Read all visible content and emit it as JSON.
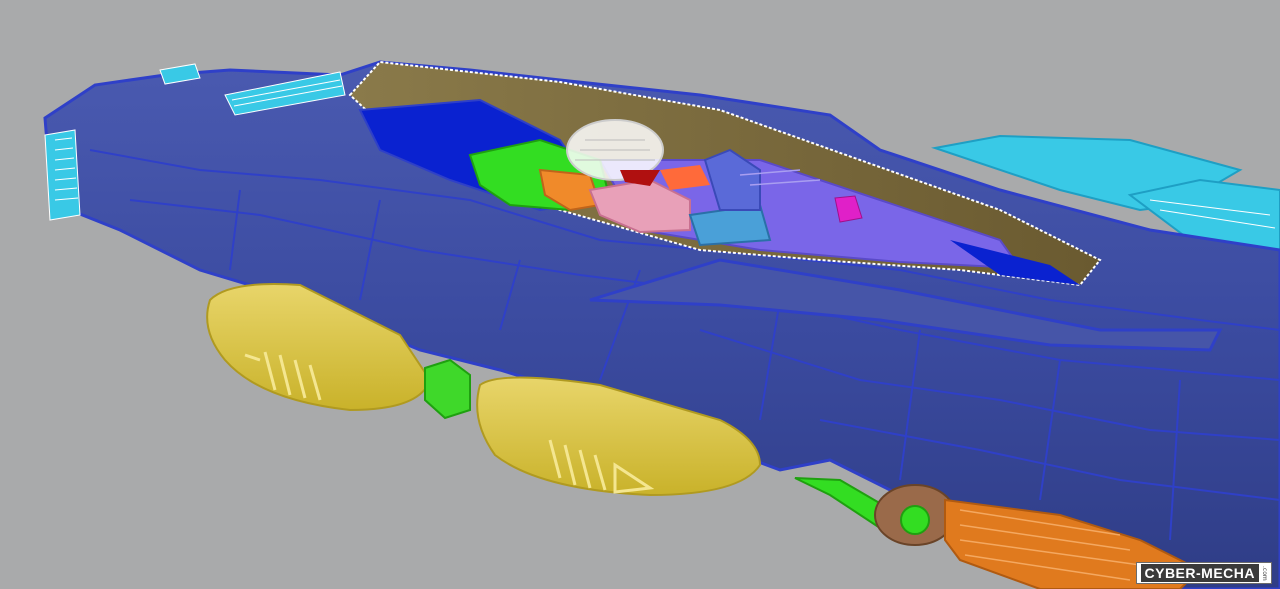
{
  "scene": {
    "background": "#a9aaab",
    "colors": {
      "hull": "#3b4ba0",
      "hull_line": "#2f40c8",
      "canopy_tint": "#7b6a3c",
      "pods": "#d9c33a",
      "cyan_parts": "#39c9e6",
      "pilot_green": "#33dd22",
      "joint_orange": "#f08a2a",
      "bottom_orange": "#e07a1e",
      "magenta": "#e020c8"
    }
  },
  "watermark": {
    "text": "CYBER-MECHA",
    "sub": ".com"
  }
}
